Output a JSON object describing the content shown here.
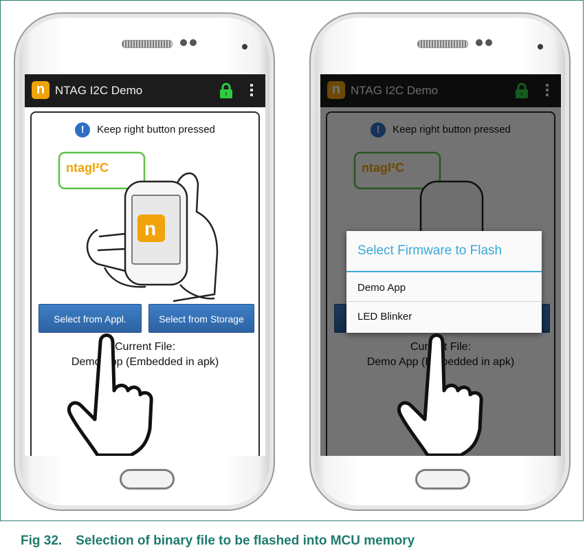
{
  "app": {
    "title": "NTAG I2C Demo",
    "logo_letter": "n",
    "info_text": "Keep right button pressed",
    "brand_text": "ntagI²C",
    "buttons": {
      "select_appl": "Select from Appl.",
      "select_storage": "Select from Storage"
    },
    "current_file_label": "Current File:",
    "current_file_value": "Demo App (Embedded in apk)"
  },
  "dialog": {
    "title": "Select Firmware to Flash",
    "items": [
      "Demo App",
      "LED Blinker"
    ]
  },
  "caption": {
    "number": "Fig 32.",
    "text": "Selection of binary file to be flashed into MCU memory"
  },
  "colors": {
    "accent": "#3aa8d8",
    "button": "#2d62a2",
    "brand_orange": "#f0a30a",
    "lock_green": "#2ecc40",
    "caption": "#1f7a6e"
  },
  "icons": [
    "lock-icon",
    "info-icon",
    "overflow-menu-icon",
    "pointing-hand-icon"
  ]
}
